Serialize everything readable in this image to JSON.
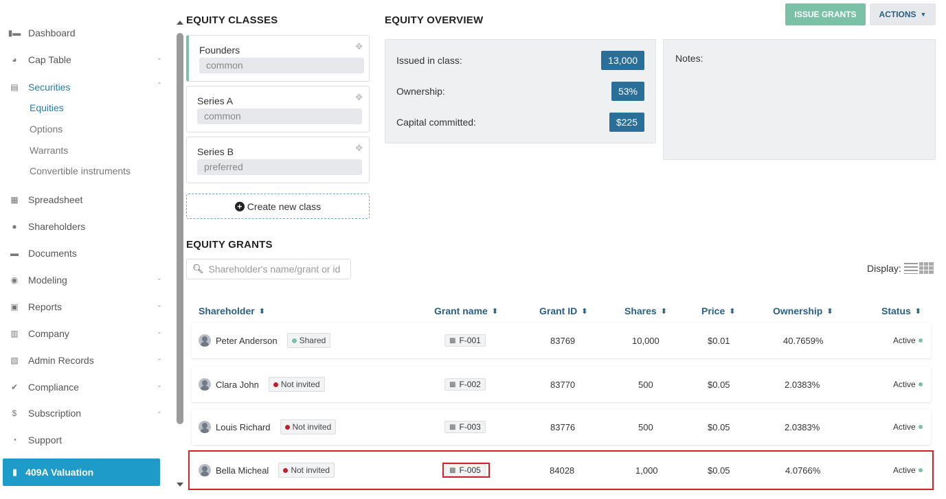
{
  "sidebar": {
    "items": [
      {
        "label": "Dashboard",
        "icon": "dashboard-icon",
        "chevron": false
      },
      {
        "label": "Cap Table",
        "icon": "pie-chart-icon",
        "chevron": true
      },
      {
        "label": "Securities",
        "icon": "clipboard-icon",
        "chevron": true,
        "expanded": true
      },
      {
        "label": "Spreadsheet",
        "icon": "spreadsheet-icon",
        "chevron": false
      },
      {
        "label": "Shareholders",
        "icon": "user-icon",
        "chevron": false
      },
      {
        "label": "Documents",
        "icon": "folder-icon",
        "chevron": false
      },
      {
        "label": "Modeling",
        "icon": "lightbulb-icon",
        "chevron": true
      },
      {
        "label": "Reports",
        "icon": "reports-icon",
        "chevron": true
      },
      {
        "label": "Company",
        "icon": "building-icon",
        "chevron": true
      },
      {
        "label": "Admin Records",
        "icon": "admin-icon",
        "chevron": true
      },
      {
        "label": "Compliance",
        "icon": "shield-check-icon",
        "chevron": true
      },
      {
        "label": "Subscription",
        "icon": "dollar-icon",
        "chevron": true
      },
      {
        "label": "Support",
        "icon": "support-icon",
        "chevron": false
      }
    ],
    "securities_sub": [
      "Equities",
      "Options",
      "Warrants",
      "Convertible instruments"
    ],
    "valuation_label": "409A Valuation"
  },
  "classes": {
    "title": "EQUITY CLASSES",
    "items": [
      {
        "name": "Founders",
        "type": "common"
      },
      {
        "name": "Series A",
        "type": "common"
      },
      {
        "name": "Series B",
        "type": "preferred"
      }
    ],
    "create_label": "Create new class"
  },
  "overview": {
    "title": "EQUITY OVERVIEW",
    "issued_label": "Issued in class:",
    "issued_value": "13,000",
    "ownership_label": "Ownership:",
    "ownership_value": "53%",
    "capital_label": "Capital committed:",
    "capital_value": "$225",
    "notes_label": "Notes:"
  },
  "toolbar": {
    "issue_label": "ISSUE GRANTS",
    "actions_label": "ACTIONS"
  },
  "grants": {
    "title": "EQUITY GRANTS",
    "search_placeholder": "Shareholder's name/grant or id",
    "display_label": "Display:",
    "columns": [
      "Shareholder",
      "Grant name",
      "Grant ID",
      "Shares",
      "Price",
      "Ownership",
      "Status"
    ],
    "rows": [
      {
        "name": "Peter Anderson",
        "invite": "Shared",
        "grant": "F-001",
        "id": "83769",
        "shares": "10,000",
        "price": "$0.01",
        "ownership": "40.7659%",
        "status": "Active"
      },
      {
        "name": "Clara John",
        "invite": "Not invited",
        "grant": "F-002",
        "id": "83770",
        "shares": "500",
        "price": "$0.05",
        "ownership": "2.0383%",
        "status": "Active"
      },
      {
        "name": "Louis Richard",
        "invite": "Not invited",
        "grant": "F-003",
        "id": "83776",
        "shares": "500",
        "price": "$0.05",
        "ownership": "2.0383%",
        "status": "Active"
      },
      {
        "name": "Bella Micheal",
        "invite": "Not invited",
        "grant": "F-005",
        "id": "84028",
        "shares": "1,000",
        "price": "$0.05",
        "ownership": "4.0766%",
        "status": "Active"
      }
    ]
  },
  "colors": {
    "accent": "#2a7da6",
    "valuation": "#1e9bc9",
    "green": "#7ac1a8",
    "badge": "#2a6f9a",
    "not_invited_dot": "#c0202a",
    "shared_dot": "#7ac1a8"
  }
}
